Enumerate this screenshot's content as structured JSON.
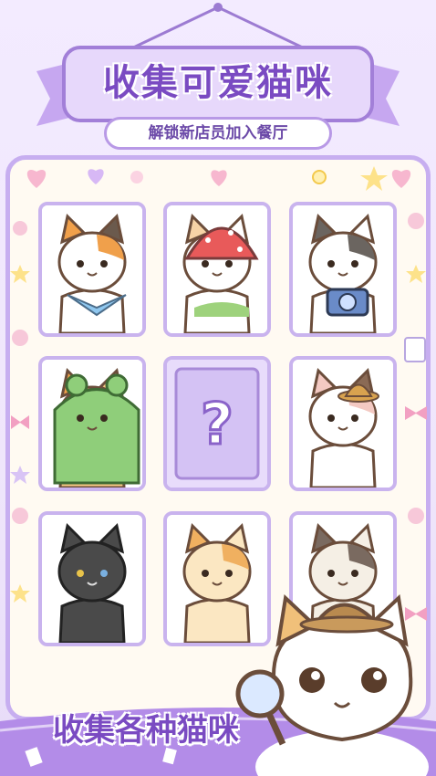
{
  "header": {
    "title": "收集可爱猫咪",
    "subtitle": "解锁新店员加入餐厅"
  },
  "grid": {
    "cards": [
      {
        "name": "calico-bandana-cat",
        "locked": false
      },
      {
        "name": "strawberry-hat-cat",
        "locked": false
      },
      {
        "name": "camera-cat",
        "locked": false
      },
      {
        "name": "frog-hoodie-cat",
        "locked": false
      },
      {
        "name": "mystery-cat",
        "locked": true,
        "symbol": "?"
      },
      {
        "name": "bowler-hat-cat",
        "locked": false
      },
      {
        "name": "black-cat",
        "locked": false
      },
      {
        "name": "nervous-cat",
        "locked": false
      },
      {
        "name": "siamese-cat",
        "locked": false
      }
    ]
  },
  "footer": {
    "caption": "收集各种猫咪"
  },
  "colors": {
    "accent": "#7a4bc2",
    "border": "#c9b3ee",
    "background": "#f3ebff"
  }
}
